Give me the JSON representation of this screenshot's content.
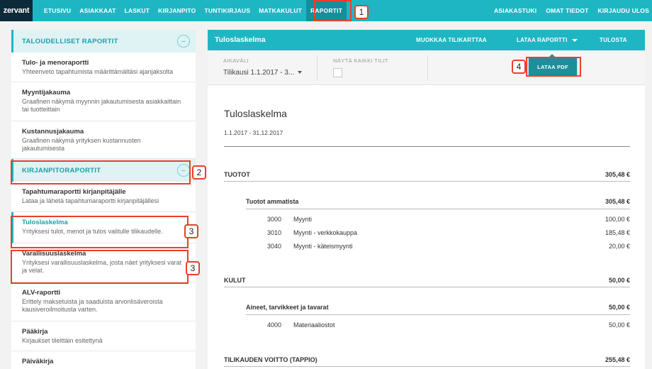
{
  "nav": {
    "logo": "zervant",
    "items": [
      "ETUSIVU",
      "ASIAKKAAT",
      "LASKUT",
      "KIRJANPITO",
      "TUNTIKIRJAUS",
      "MATKAKULUT",
      "RAPORTIT"
    ],
    "active": "RAPORTIT",
    "right": [
      "ASIAKASTUKI",
      "OMAT TIEDOT",
      "KIRJAUDU ULOS"
    ]
  },
  "sidebar": {
    "section1": {
      "title": "TALOUDELLISET RAPORTIT",
      "toggle": "–"
    },
    "financial_items": [
      {
        "title": "Tulo- ja menoraportti",
        "desc": "Yhteenveto tapahtumista määrittämältäsi ajanjaksolta"
      },
      {
        "title": "Myyntijakauma",
        "desc": "Graafinen näkymä myynnin jakautumisesta asiakkaittain tai tuotteittain"
      },
      {
        "title": "Kustannusjakauma",
        "desc": "Graafinen näkymä yrityksen kustannusten jakautumisesta"
      }
    ],
    "section2": {
      "title": "KIRJANPITORAPORTIT",
      "toggle": "–"
    },
    "accounting_items": [
      {
        "title": "Tapahtumaraportti kirjanpitäjälle",
        "desc": "Lataa ja lähetä tapahtumaraportti kirjanpitäjällesi"
      },
      {
        "title": "Tuloslaskelma",
        "desc": "Yrityksesi tulot, menot ja tulos valitulle tilikaudelle."
      },
      {
        "title": "Varallisuuslaskelma",
        "desc": "Yrityksesi varallisuuslaskelma, josta näet yrityksesi varat ja velat."
      },
      {
        "title": "ALV-raportti",
        "desc": "Erittely maksetuista ja saaduista arvonlisäveroista kausiveroilmoitusta varten."
      },
      {
        "title": "Pääkirja",
        "desc": "Kirjaukset tileittäin esitettynä"
      },
      {
        "title": "Päiväkirja",
        "desc": ""
      }
    ]
  },
  "main": {
    "title": "Tuloslaskelma",
    "actions": {
      "edit_chart": "MUOKKAA TILIKARTTAA",
      "download": "LATAA RAPORTTI",
      "print": "TULOSTA"
    },
    "filters": {
      "period_label": "AIKAVÄLI",
      "period_value": "Tilikausi 1.1.2017 - 3...",
      "show_all_label": "NÄYTÄ KAIKKI TILIT"
    },
    "download_pdf": "LATAA PDF"
  },
  "report": {
    "title": "Tuloslaskelma",
    "period": "1.1.2017 - 31.12.2017",
    "income": {
      "label": "TUOTOT",
      "total": "305,48 €"
    },
    "income_group": {
      "label": "Tuotot ammatista",
      "total": "305,48 €"
    },
    "income_accounts": [
      {
        "num": "3000",
        "name": "Myynti",
        "amount": "100,00 €"
      },
      {
        "num": "3010",
        "name": "Myynti - verkkokauppa",
        "amount": "185,48 €"
      },
      {
        "num": "3040",
        "name": "Myynti - käteismyynti",
        "amount": "20,00 €"
      }
    ],
    "costs": {
      "label": "KULUT",
      "total": "50,00 €"
    },
    "cost_group": {
      "label": "Aineet, tarvikkeet ja tavarat",
      "total": "50,00 €"
    },
    "cost_accounts": [
      {
        "num": "4000",
        "name": "Materiaaliostot",
        "amount": "50,00 €"
      }
    ],
    "profit": {
      "label": "TILIKAUDEN VOITTO (TAPPIO)",
      "total": "255,48 €"
    }
  },
  "annotations": [
    "1",
    "2",
    "3",
    "3",
    "4"
  ],
  "colors": {
    "accent": "#1fb6c4",
    "accent_dark": "#1d8f9b",
    "logo_bg": "#0d2a3a",
    "highlight": "#e8402b"
  }
}
